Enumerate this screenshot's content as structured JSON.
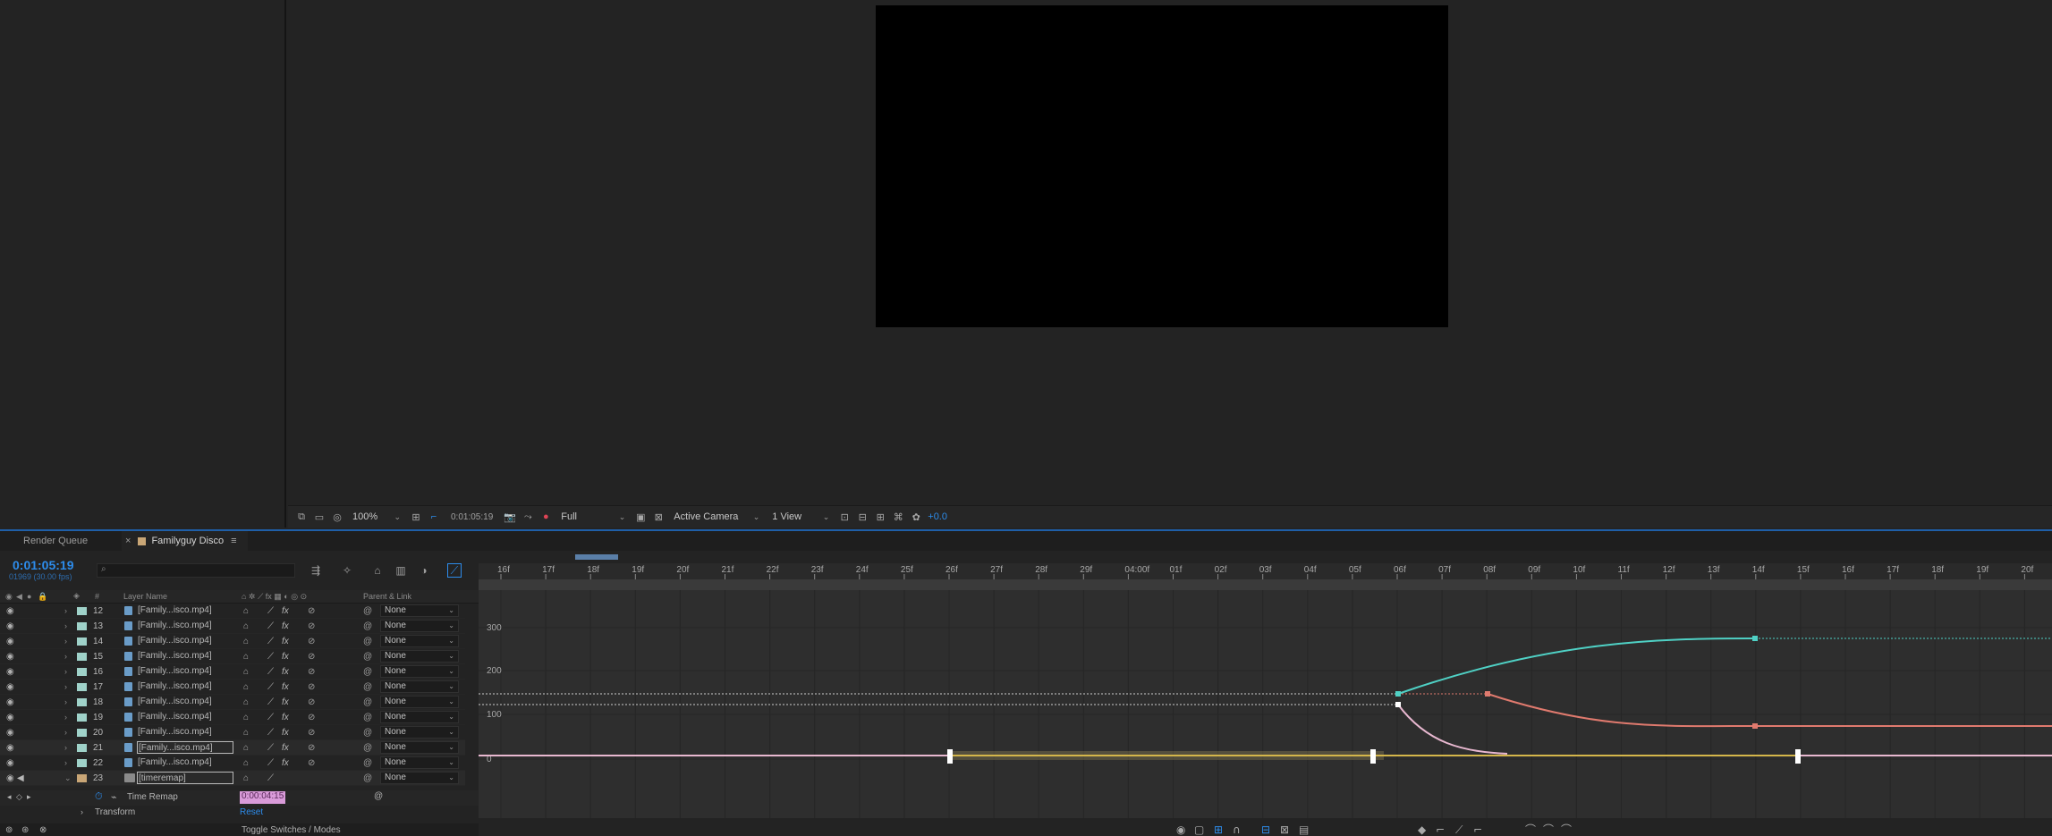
{
  "viewer": {
    "zoom": "100%",
    "timecode": "0:01:05:19",
    "resolution": "Full",
    "camera": "Active Camera",
    "views": "1 View",
    "exposure": "+0.0"
  },
  "timeline": {
    "tabs": [
      {
        "label": "Render Queue"
      },
      {
        "label": "Familyguy Disco"
      }
    ],
    "timecode": "0:01:05:19",
    "fps": "01969 (30.00 fps)",
    "search_placeholder": "",
    "columns": {
      "num": "#",
      "layer_name": "Layer Name",
      "parent_link": "Parent & Link"
    },
    "layers": [
      {
        "num": "12",
        "name": "[Family...isco.mp4]",
        "parent": "None",
        "color": "#9fd2c9"
      },
      {
        "num": "13",
        "name": "[Family...isco.mp4]",
        "parent": "None",
        "color": "#9fd2c9"
      },
      {
        "num": "14",
        "name": "[Family...isco.mp4]",
        "parent": "None",
        "color": "#9fd2c9"
      },
      {
        "num": "15",
        "name": "[Family...isco.mp4]",
        "parent": "None",
        "color": "#9fd2c9"
      },
      {
        "num": "16",
        "name": "[Family...isco.mp4]",
        "parent": "None",
        "color": "#9fd2c9"
      },
      {
        "num": "17",
        "name": "[Family...isco.mp4]",
        "parent": "None",
        "color": "#9fd2c9"
      },
      {
        "num": "18",
        "name": "[Family...isco.mp4]",
        "parent": "None",
        "color": "#9fd2c9"
      },
      {
        "num": "19",
        "name": "[Family...isco.mp4]",
        "parent": "None",
        "color": "#9fd2c9"
      },
      {
        "num": "20",
        "name": "[Family...isco.mp4]",
        "parent": "None",
        "color": "#9fd2c9"
      },
      {
        "num": "21",
        "name": "[Family...isco.mp4]",
        "parent": "None",
        "color": "#9fd2c9"
      },
      {
        "num": "22",
        "name": "[Family...isco.mp4]",
        "parent": "None",
        "color": "#9fd2c9"
      },
      {
        "num": "23",
        "name": "[timeremap]",
        "parent": "None",
        "color": "#c9a676"
      }
    ],
    "properties": {
      "time_remap_label": "Time Remap",
      "time_remap_value": "0:00:04:15",
      "transform_label": "Transform",
      "reset_label": "Reset"
    },
    "toggle_label": "Toggle Switches / Modes",
    "ruler_ticks": [
      "16f",
      "17f",
      "18f",
      "19f",
      "20f",
      "21f",
      "22f",
      "23f",
      "24f",
      "25f",
      "26f",
      "27f",
      "28f",
      "29f",
      "04:00f",
      "01f",
      "02f",
      "03f",
      "04f",
      "05f",
      "06f",
      "07f",
      "08f",
      "09f",
      "10f",
      "11f",
      "12f",
      "13f",
      "14f",
      "15f",
      "16f",
      "17f",
      "18f",
      "19f",
      "20f"
    ],
    "graph_y_labels": [
      "300",
      "200",
      "100",
      "0"
    ]
  },
  "colors": {
    "accent": "#2d8ceb",
    "curve_cyan": "#4fd1c5",
    "curve_red": "#e07a6e",
    "curve_pink": "#e8b8d0",
    "time_remap_highlight": "#d99bd9"
  }
}
